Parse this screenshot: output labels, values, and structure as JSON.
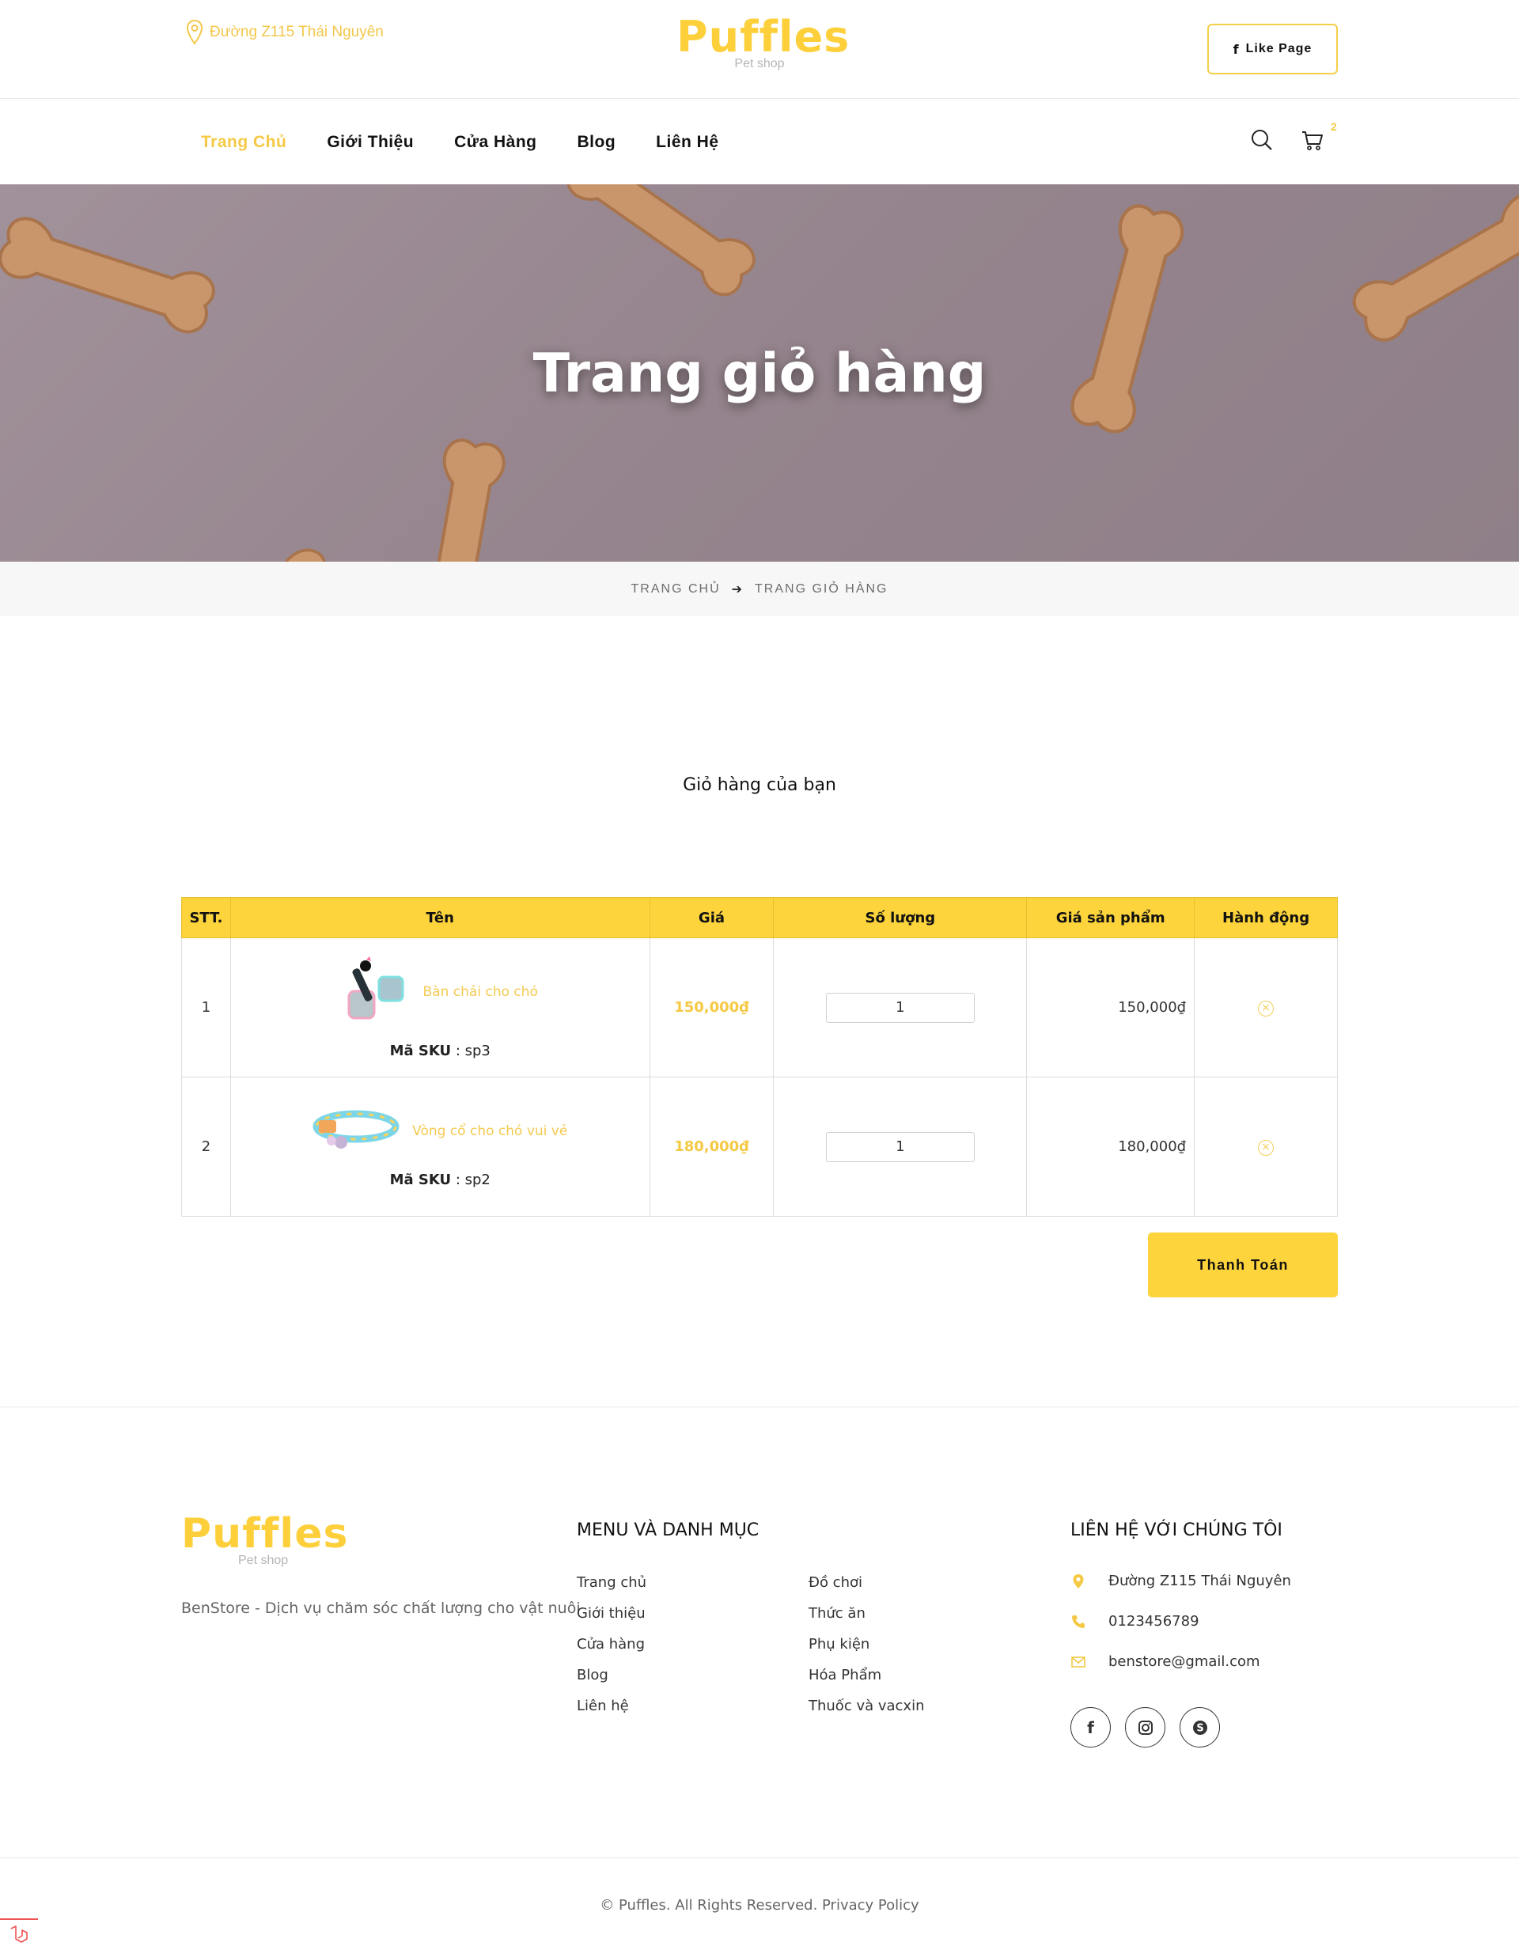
{
  "header": {
    "address": "Đường Z115 Thái Nguyên",
    "logo_text": "Puffles",
    "logo_sub": "Pet shop",
    "like_label": "Like Page"
  },
  "nav": {
    "items": [
      {
        "label": "Trang Chủ",
        "active": true
      },
      {
        "label": "Giới Thiệu"
      },
      {
        "label": "Cửa Hàng"
      },
      {
        "label": "Blog"
      },
      {
        "label": "Liên Hệ"
      }
    ],
    "cart_count": "2"
  },
  "hero": {
    "title": "Trang giỏ hàng"
  },
  "breadcrumb": {
    "home": "TRANG CHỦ",
    "current": "TRANG GIỎ HÀNG"
  },
  "cart": {
    "title": "Giỏ hàng của bạn",
    "columns": [
      "STT.",
      "Tên",
      "Giá",
      "Số lượng",
      "Giá sản phẩm",
      "Hành động"
    ],
    "sku_label": "Mã SKU",
    "rows": [
      {
        "stt": "1",
        "name": "Bàn chải cho chó",
        "sku": " : sp3",
        "price": "150,000₫",
        "qty": "1",
        "total": "150,000₫"
      },
      {
        "stt": "2",
        "name": "Vòng cổ cho chó vui vẻ",
        "sku": " : sp2",
        "price": "180,000₫",
        "qty": "1",
        "total": "180,000₫"
      }
    ],
    "pay_label": "Thanh Toán"
  },
  "footer": {
    "description": "BenStore - Dịch vụ chăm sóc chất lượng cho vật nuôi",
    "menu_heading": "MENU VÀ DANH MỤC",
    "menu_col1": [
      "Trang chủ",
      "Giới thiệu",
      "Cửa hàng",
      "Blog",
      "Liên hệ"
    ],
    "menu_col2": [
      "Đồ chơi",
      "Thức ăn",
      "Phụ kiện",
      "Hóa Phẩm",
      "Thuốc và vacxin"
    ],
    "contact_heading": "LIÊN HỆ VỚI CHÚNG TÔI",
    "address": "Đường Z115 Thái Nguyên",
    "phone": "0123456789",
    "email": "benstore@gmail.com",
    "copyright": "©  Puffles. All Rights Reserved. Privacy Policy"
  },
  "colors": {
    "accent": "#fdd43b",
    "accent_text": "#f5c944"
  }
}
